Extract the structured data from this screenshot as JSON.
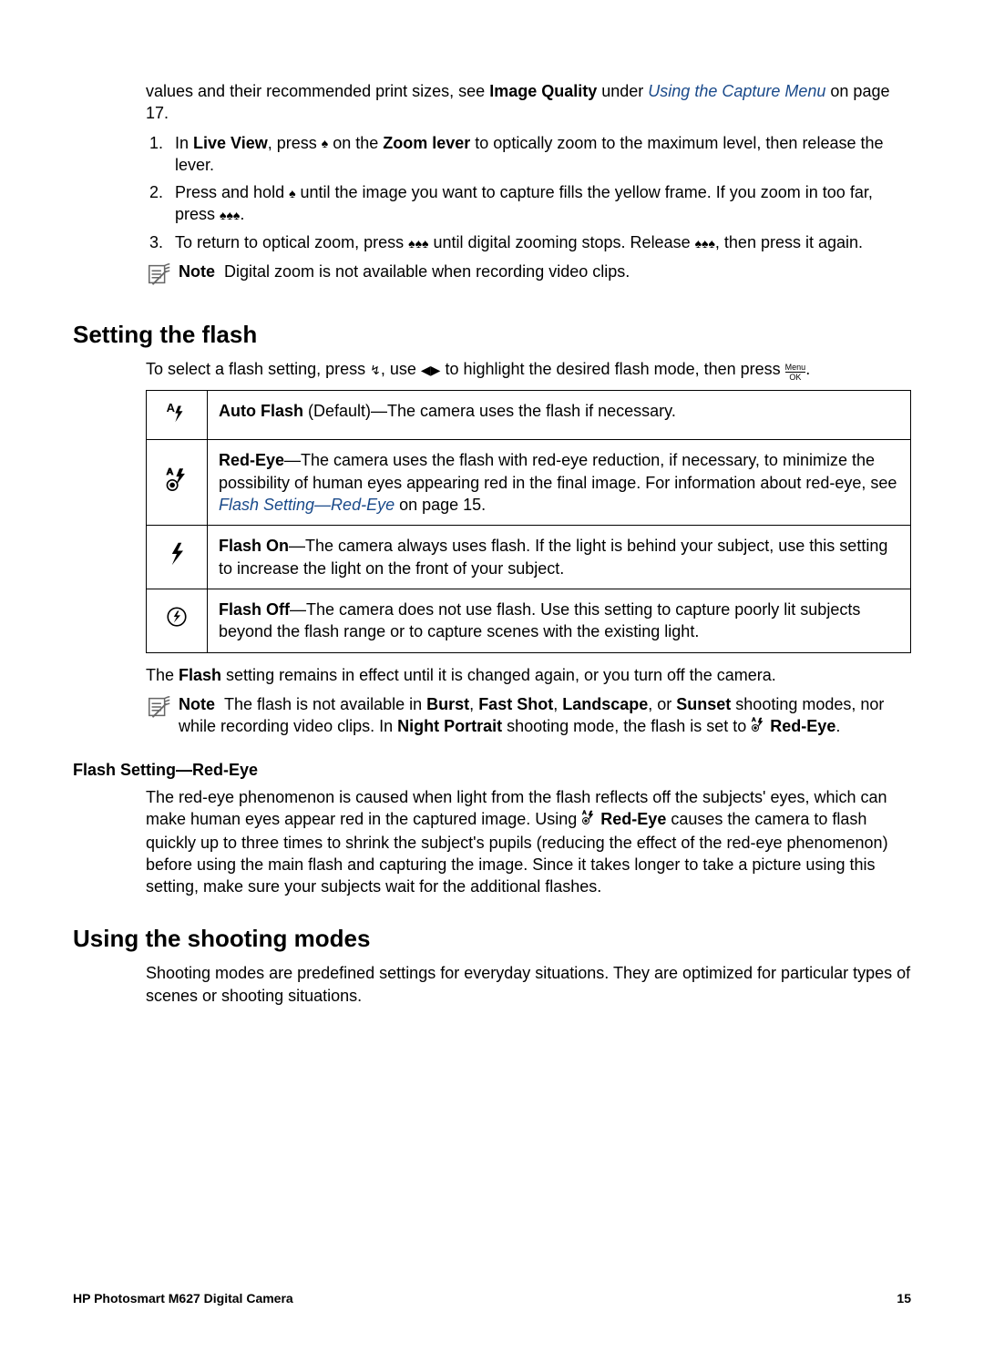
{
  "top": {
    "intro_prefix": "values and their recommended print sizes, see ",
    "intro_bold": "Image Quality",
    "intro_middle": " under ",
    "intro_link": "Using the Capture Menu",
    "intro_suffix": " on page 17."
  },
  "steps": {
    "s1_a": "In ",
    "s1_b": "Live View",
    "s1_c": ", press ",
    "s1_d": " on the ",
    "s1_e": "Zoom lever",
    "s1_f": " to optically zoom to the maximum level, then release the lever.",
    "s2_a": "Press and hold ",
    "s2_b": " until the image you want to capture fills the yellow frame. If you zoom in too far, press ",
    "s2_c": ".",
    "s3_a": "To return to optical zoom, press ",
    "s3_b": " until digital zooming stops. Release ",
    "s3_c": ", then press it again."
  },
  "note1": {
    "label": "Note",
    "text": "Digital zoom is not available when recording video clips."
  },
  "flash": {
    "heading": "Setting the flash",
    "intro_a": "To select a flash setting, press ",
    "intro_b": ", use ",
    "intro_c": " to highlight the desired flash mode, then press ",
    "intro_d": ".",
    "rows": [
      {
        "icon": "A↯",
        "bold": "Auto Flash",
        "rest": " (Default)—The camera uses the flash if necessary."
      },
      {
        "icon": "redeye",
        "bold": "Red-Eye",
        "rest": "—The camera uses the flash with red-eye reduction, if necessary, to minimize the possibility of human eyes appearing red in the final image. For information about red-eye, see ",
        "link": "Flash Setting—Red-Eye",
        "suffix": " on page 15."
      },
      {
        "icon": "↯",
        "bold": "Flash On",
        "rest": "—The camera always uses flash. If the light is behind your subject, use this setting to increase the light on the front of your subject."
      },
      {
        "icon": "⊘↯",
        "bold": "Flash Off",
        "rest": "—The camera does not use flash. Use this setting to capture poorly lit subjects beyond the flash range or to capture scenes with the existing light."
      }
    ],
    "remain_a": "The ",
    "remain_b": "Flash",
    "remain_c": " setting remains in effect until it is changed again, or you turn off the camera."
  },
  "note2": {
    "label": "Note",
    "a": "The flash is not available in ",
    "b1": "Burst",
    "m1": ", ",
    "b2": "Fast Shot",
    "m2": ", ",
    "b3": "Landscape",
    "m3": ", or ",
    "b4": "Sunset",
    "c": " shooting modes, nor while recording video clips. In ",
    "b5": "Night Portrait",
    "d": " shooting mode, the flash is set to ",
    "b6": "Red-Eye",
    "e": "."
  },
  "redeye": {
    "heading": "Flash Setting—Red-Eye",
    "a": "The red-eye phenomenon is caused when light from the flash reflects off the subjects' eyes, which can make human eyes appear red in the captured image. Using ",
    "b": "Red-Eye",
    "c": " causes the camera to flash quickly up to three times to shrink the subject's pupils (reducing the effect of the red-eye phenomenon) before using the main flash and capturing the image. Since it takes longer to take a picture using this setting, make sure your subjects wait for the additional flashes."
  },
  "modes": {
    "heading": "Using the shooting modes",
    "text": "Shooting modes are predefined settings for everyday situations. They are optimized for particular types of scenes or shooting situations."
  },
  "footer": {
    "left": "HP Photosmart M627 Digital Camera",
    "right": "15"
  },
  "icons": {
    "tree_in": "♠",
    "trees_out": "♠♠♠",
    "arrows": "◀▶",
    "flash_small": "↯"
  }
}
